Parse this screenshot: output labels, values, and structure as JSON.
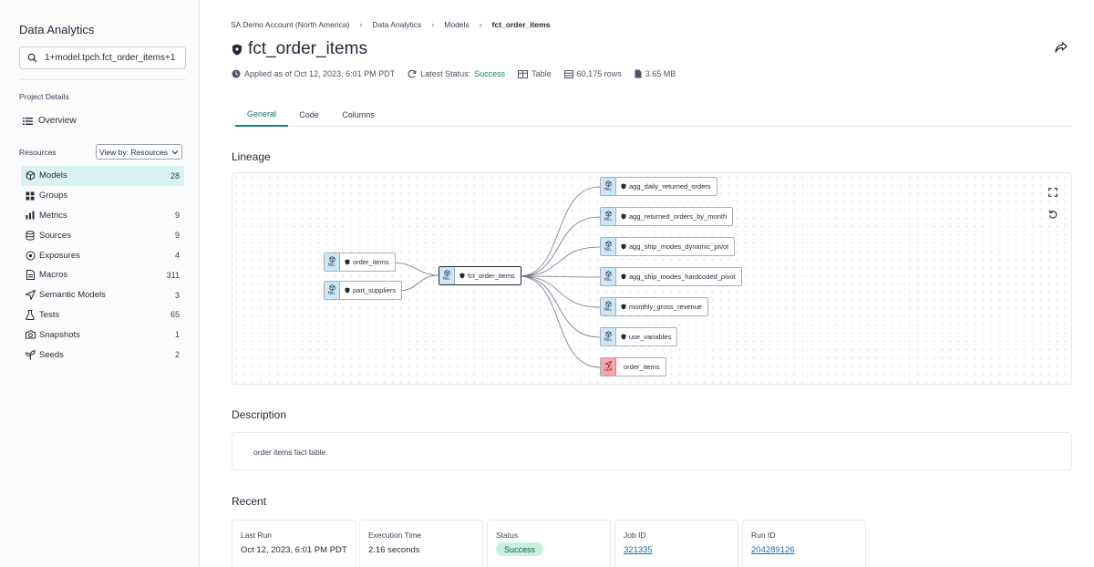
{
  "sidebar": {
    "title": "Data Analytics",
    "search_value": "1+model.tpch.fct_order_items+1",
    "project_details_label": "Project Details",
    "overview_label": "Overview",
    "resources_label": "Resources",
    "view_by_label": "View by: Resources",
    "items": [
      {
        "label": "Models",
        "count": "28",
        "icon": "cube-icon",
        "active": true
      },
      {
        "label": "Groups",
        "count": "",
        "icon": "grid-icon"
      },
      {
        "label": "Metrics",
        "count": "9",
        "icon": "bar-chart-icon"
      },
      {
        "label": "Sources",
        "count": "9",
        "icon": "database-icon"
      },
      {
        "label": "Exposures",
        "count": "4",
        "icon": "exposure-icon"
      },
      {
        "label": "Macros",
        "count": "311",
        "icon": "document-icon"
      },
      {
        "label": "Semantic Models",
        "count": "3",
        "icon": "send-icon"
      },
      {
        "label": "Tests",
        "count": "65",
        "icon": "flask-icon"
      },
      {
        "label": "Snapshots",
        "count": "1",
        "icon": "camera-icon"
      },
      {
        "label": "Seeds",
        "count": "2",
        "icon": "sprout-icon"
      }
    ]
  },
  "breadcrumb": [
    "SA Demo Account (North America)",
    "Data Analytics",
    "Models",
    "fct_order_items"
  ],
  "page": {
    "title": "fct_order_items",
    "applied": "Applied as of Oct 12, 2023, 6:01 PM PDT",
    "status_prefix": "Latest Status:",
    "status_value": "Success",
    "type": "Table",
    "rows": "60,175 rows",
    "size": "3.65 MB"
  },
  "tabs": [
    "General",
    "Code",
    "Columns"
  ],
  "lineage": {
    "heading": "Lineage",
    "nodes": {
      "order_items_src": {
        "name": "order_items",
        "badge": "MDL"
      },
      "part_suppliers": {
        "name": "part_suppliers",
        "badge": "MDL"
      },
      "main": {
        "name": "fct_order_items",
        "badge": "MDL"
      },
      "c1": {
        "name": "agg_daily_returned_orders",
        "badge": "MDL"
      },
      "c2": {
        "name": "agg_returned_orders_by_month",
        "badge": "MDL"
      },
      "c3": {
        "name": "agg_ship_modes_dynamic_pivot",
        "badge": "MDL"
      },
      "c4": {
        "name": "agg_ship_modes_hardcoded_pivot",
        "badge": "MDL"
      },
      "c5": {
        "name": "monthly_gross_revenue",
        "badge": "MDL"
      },
      "c6": {
        "name": "use_variables",
        "badge": "MDL"
      },
      "c7": {
        "name": "order_items",
        "badge": "SEM"
      }
    }
  },
  "description": {
    "heading": "Description",
    "text": "order items fact table"
  },
  "recent": {
    "heading": "Recent",
    "last_run_label": "Last Run",
    "last_run_value": "Oct 12, 2023, 6:01 PM PDT",
    "exec_label": "Execution Time",
    "exec_value": "2.16 seconds",
    "status_label": "Status",
    "status_value": "Success",
    "job_label": "Job ID",
    "job_value": "321335",
    "run_label": "Run ID",
    "run_value": "204289126"
  }
}
